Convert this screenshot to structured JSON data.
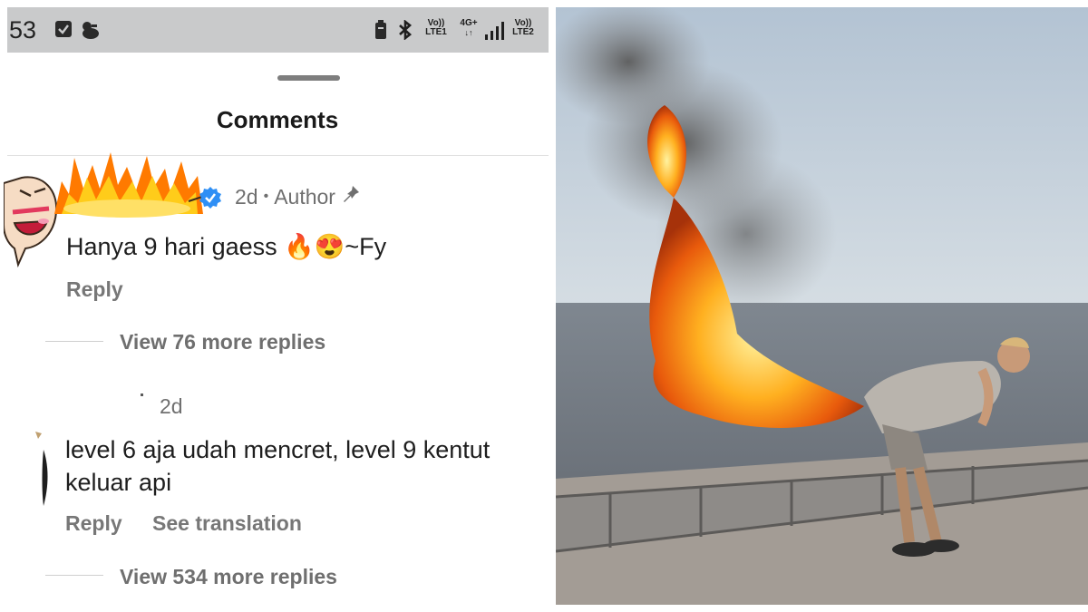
{
  "status_bar": {
    "time": "53",
    "net1_top": "Vo))",
    "net1_bottom": "LTE1",
    "net_type": "4G+",
    "net2_top": "Vo))",
    "net2_bottom": "LTE2"
  },
  "sheet": {
    "title": "Comments"
  },
  "comments": [
    {
      "time": "2d",
      "badge": "Author",
      "text": "Hanya 9 hari gaess 🔥😍~Fy",
      "reply_label": "Reply",
      "view_more": "View 76 more replies"
    },
    {
      "time": "2d",
      "text_line1": "level 6 aja udah mencret, level 9 kentut",
      "text_line2": "keluar api",
      "reply_label": "Reply",
      "translate_label": "See translation",
      "view_more": "View 534 more replies"
    }
  ],
  "colors": {
    "status_bar": "#c9cacb",
    "verified": "#2f8ff5",
    "muted_text": "#6f6f6f",
    "flame": "#ff7a00"
  },
  "icons": [
    "checkbox-icon",
    "duck-icon",
    "battery-icon",
    "bluetooth-icon",
    "signal-icon",
    "verified-icon",
    "pin-icon"
  ]
}
